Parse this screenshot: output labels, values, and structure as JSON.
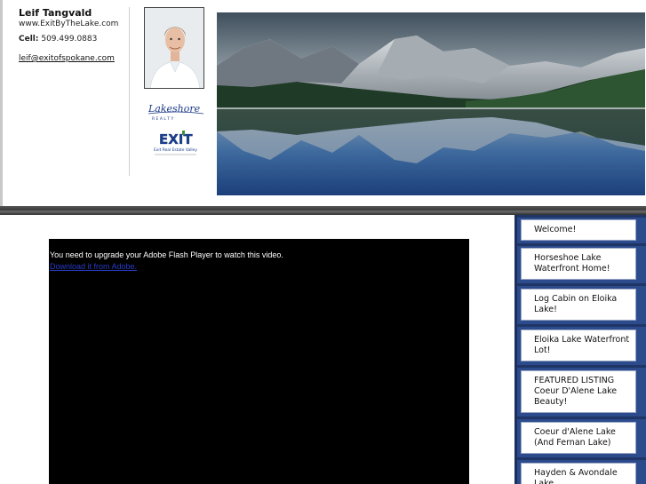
{
  "contact": {
    "name": "Leif Tangvald",
    "website": "www.ExitByTheLake.com",
    "cell_label": "Cell:",
    "cell_number": "509.499.0883",
    "email": "leif@exitofspokane.com"
  },
  "logos": {
    "lakeshore": "Lakeshore",
    "lakeshore_sub": "R E A L T Y",
    "exit": "EXIT",
    "exit_sub": "Exit Real Estate Valley"
  },
  "video": {
    "message": "You need to upgrade your Adobe Flash Player to watch this video.",
    "download_link": "Download it from Adobe."
  },
  "nav": {
    "items": [
      {
        "label": "Welcome!"
      },
      {
        "label": "Horseshoe Lake Waterfront Home!"
      },
      {
        "label": "Log Cabin on Eloika Lake!"
      },
      {
        "label": "Eloika Lake Waterfront Lot!"
      },
      {
        "label": "FEATURED LISTING Coeur D'Alene Lake Beauty!"
      },
      {
        "label": "Coeur d'Alene Lake (And Fernan Lake)"
      },
      {
        "label": "Hayden & Avondale Lake"
      }
    ]
  },
  "colors": {
    "nav_bg": "#2c4b8c",
    "link": "#2a3cc8"
  }
}
